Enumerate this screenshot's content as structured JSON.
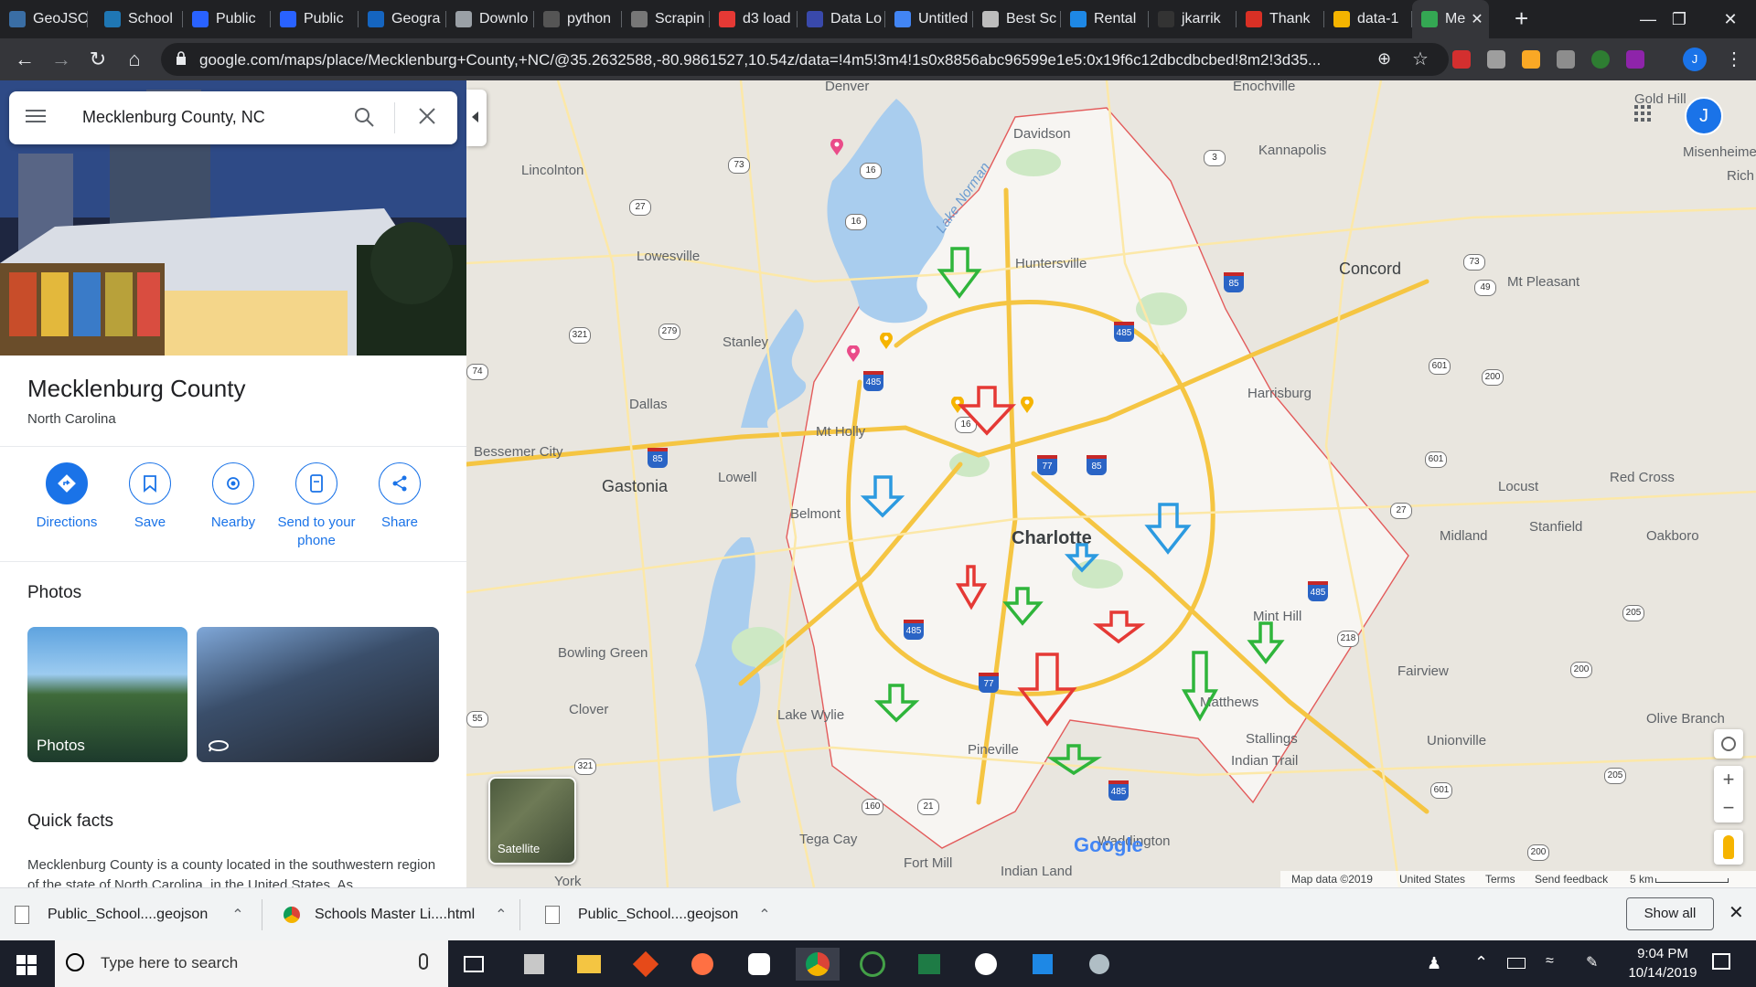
{
  "browser": {
    "tabs": [
      {
        "label": "GeoJSO",
        "color": "#3a6ea5"
      },
      {
        "label": "School",
        "color": "#1f77b4"
      },
      {
        "label": "Public",
        "color": "#2962ff"
      },
      {
        "label": "Public",
        "color": "#2962ff"
      },
      {
        "label": "Geogra",
        "color": "#1565c0"
      },
      {
        "label": "Downlo",
        "color": "#9aa0a6"
      },
      {
        "label": "python",
        "color": "#555555"
      },
      {
        "label": "Scrapin",
        "color": "#777777"
      },
      {
        "label": "d3 load",
        "color": "#e53935"
      },
      {
        "label": "Data Lo",
        "color": "#3949ab"
      },
      {
        "label": "Untitled",
        "color": "#4285f4"
      },
      {
        "label": "Best Sc",
        "color": "#bdbdbd"
      },
      {
        "label": "Rental",
        "color": "#1e88e5"
      },
      {
        "label": "jkarrik",
        "color": "#333333"
      },
      {
        "label": "Thank",
        "color": "#d93025"
      },
      {
        "label": "data-1",
        "color": "#f4b400"
      },
      {
        "label": "Me",
        "color": "#34a853"
      }
    ],
    "url": "google.com/maps/place/Mecklenburg+County,+NC/@35.2632588,-80.9861527,10.54z/data=!4m5!3m4!1s0x8856abc96599e1e5:0x19f6c12dbcdbcbed!8m2!3d35..."
  },
  "panel": {
    "search_value": "Mecklenburg County, NC",
    "title": "Mecklenburg County",
    "subtitle": "North Carolina",
    "actions": [
      {
        "label": "Directions",
        "icon": "directions-icon"
      },
      {
        "label": "Save",
        "icon": "bookmark-icon"
      },
      {
        "label": "Nearby",
        "icon": "nearby-icon"
      },
      {
        "label": "Send to your phone",
        "icon": "send-to-phone-icon"
      },
      {
        "label": "Share",
        "icon": "share-icon"
      }
    ],
    "photos_heading": "Photos",
    "photo_label": "Photos",
    "quick_facts_heading": "Quick facts",
    "quick_facts_text": "Mecklenburg County is a county located in the southwestern region of the state of North Carolina, in the United States. As"
  },
  "map": {
    "satellite_label": "Satellite",
    "attribution": "Map data ©2019",
    "country": "United States",
    "terms": "Terms",
    "feedback": "Send feedback",
    "scale": "5 km",
    "google_logo": "Google",
    "places": [
      {
        "name": "Denver"
      },
      {
        "name": "Enochville"
      },
      {
        "name": "Davidson"
      },
      {
        "name": "Lincolnton"
      },
      {
        "name": "Kannapolis"
      },
      {
        "name": "Gold Hill"
      },
      {
        "name": "Misenheime"
      },
      {
        "name": "Rich"
      },
      {
        "name": "Lowesville"
      },
      {
        "name": "Huntersville"
      },
      {
        "name": "Concord"
      },
      {
        "name": "Mt Pleasant"
      },
      {
        "name": "Stanley"
      },
      {
        "name": "Harrisburg"
      },
      {
        "name": "Dallas"
      },
      {
        "name": "Mt Holly"
      },
      {
        "name": "Bessemer City"
      },
      {
        "name": "Lowell"
      },
      {
        "name": "Gastonia"
      },
      {
        "name": "Belmont"
      },
      {
        "name": "Locust"
      },
      {
        "name": "Red Cross"
      },
      {
        "name": "Charlotte"
      },
      {
        "name": "Midland"
      },
      {
        "name": "Stanfield"
      },
      {
        "name": "Oakboro"
      },
      {
        "name": "Mint Hill"
      },
      {
        "name": "Bowling Green"
      },
      {
        "name": "Fairview"
      },
      {
        "name": "Clover"
      },
      {
        "name": "Lake Wylie"
      },
      {
        "name": "Matthews"
      },
      {
        "name": "Olive Branch"
      },
      {
        "name": "Pineville"
      },
      {
        "name": "Stallings"
      },
      {
        "name": "Unionville"
      },
      {
        "name": "Indian Trail"
      },
      {
        "name": "Tega Cay"
      },
      {
        "name": "Fort Mill"
      },
      {
        "name": "Waddington"
      },
      {
        "name": "Indian Land"
      },
      {
        "name": "York"
      },
      {
        "name": "Lake Norman"
      }
    ],
    "roads": [
      "73",
      "16",
      "27",
      "3",
      "16",
      "85",
      "73",
      "49",
      "321",
      "279",
      "485",
      "485",
      "601",
      "200",
      "16",
      "77",
      "85",
      "601",
      "85",
      "27",
      "485",
      "205",
      "485",
      "218",
      "200",
      "77",
      "601",
      "205",
      "321",
      "160",
      "21",
      "485",
      "49",
      "200",
      "55",
      "74"
    ],
    "marker_colors": {
      "green": "#2fb53b",
      "red": "#e53935",
      "blue": "#2c9ae0"
    }
  },
  "downloads": [
    {
      "name": "Public_School....geojson"
    },
    {
      "name": "Schools Master Li....html"
    },
    {
      "name": "Public_School....geojson"
    }
  ],
  "downloads_show_all": "Show all",
  "taskbar": {
    "search_placeholder": "Type here to search",
    "time": "9:04 PM",
    "date": "10/14/2019"
  }
}
